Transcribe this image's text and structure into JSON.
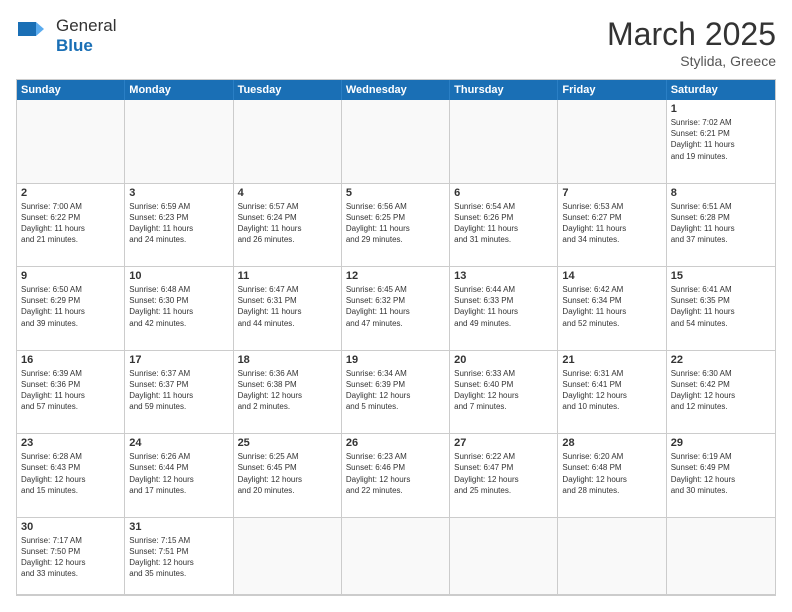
{
  "header": {
    "logo_general": "General",
    "logo_blue": "Blue",
    "month_year": "March 2025",
    "location": "Stylida, Greece"
  },
  "weekdays": [
    "Sunday",
    "Monday",
    "Tuesday",
    "Wednesday",
    "Thursday",
    "Friday",
    "Saturday"
  ],
  "cells": [
    {
      "day": "",
      "empty": true
    },
    {
      "day": "",
      "empty": true
    },
    {
      "day": "",
      "empty": true
    },
    {
      "day": "",
      "empty": true
    },
    {
      "day": "",
      "empty": true
    },
    {
      "day": "",
      "empty": true
    },
    {
      "day": "1",
      "text": "Sunrise: 7:02 AM\nSunset: 6:21 PM\nDaylight: 11 hours\nand 19 minutes."
    },
    {
      "day": "2",
      "text": "Sunrise: 7:00 AM\nSunset: 6:22 PM\nDaylight: 11 hours\nand 21 minutes."
    },
    {
      "day": "3",
      "text": "Sunrise: 6:59 AM\nSunset: 6:23 PM\nDaylight: 11 hours\nand 24 minutes."
    },
    {
      "day": "4",
      "text": "Sunrise: 6:57 AM\nSunset: 6:24 PM\nDaylight: 11 hours\nand 26 minutes."
    },
    {
      "day": "5",
      "text": "Sunrise: 6:56 AM\nSunset: 6:25 PM\nDaylight: 11 hours\nand 29 minutes."
    },
    {
      "day": "6",
      "text": "Sunrise: 6:54 AM\nSunset: 6:26 PM\nDaylight: 11 hours\nand 31 minutes."
    },
    {
      "day": "7",
      "text": "Sunrise: 6:53 AM\nSunset: 6:27 PM\nDaylight: 11 hours\nand 34 minutes."
    },
    {
      "day": "8",
      "text": "Sunrise: 6:51 AM\nSunset: 6:28 PM\nDaylight: 11 hours\nand 37 minutes."
    },
    {
      "day": "9",
      "text": "Sunrise: 6:50 AM\nSunset: 6:29 PM\nDaylight: 11 hours\nand 39 minutes."
    },
    {
      "day": "10",
      "text": "Sunrise: 6:48 AM\nSunset: 6:30 PM\nDaylight: 11 hours\nand 42 minutes."
    },
    {
      "day": "11",
      "text": "Sunrise: 6:47 AM\nSunset: 6:31 PM\nDaylight: 11 hours\nand 44 minutes."
    },
    {
      "day": "12",
      "text": "Sunrise: 6:45 AM\nSunset: 6:32 PM\nDaylight: 11 hours\nand 47 minutes."
    },
    {
      "day": "13",
      "text": "Sunrise: 6:44 AM\nSunset: 6:33 PM\nDaylight: 11 hours\nand 49 minutes."
    },
    {
      "day": "14",
      "text": "Sunrise: 6:42 AM\nSunset: 6:34 PM\nDaylight: 11 hours\nand 52 minutes."
    },
    {
      "day": "15",
      "text": "Sunrise: 6:41 AM\nSunset: 6:35 PM\nDaylight: 11 hours\nand 54 minutes."
    },
    {
      "day": "16",
      "text": "Sunrise: 6:39 AM\nSunset: 6:36 PM\nDaylight: 11 hours\nand 57 minutes."
    },
    {
      "day": "17",
      "text": "Sunrise: 6:37 AM\nSunset: 6:37 PM\nDaylight: 11 hours\nand 59 minutes."
    },
    {
      "day": "18",
      "text": "Sunrise: 6:36 AM\nSunset: 6:38 PM\nDaylight: 12 hours\nand 2 minutes."
    },
    {
      "day": "19",
      "text": "Sunrise: 6:34 AM\nSunset: 6:39 PM\nDaylight: 12 hours\nand 5 minutes."
    },
    {
      "day": "20",
      "text": "Sunrise: 6:33 AM\nSunset: 6:40 PM\nDaylight: 12 hours\nand 7 minutes."
    },
    {
      "day": "21",
      "text": "Sunrise: 6:31 AM\nSunset: 6:41 PM\nDaylight: 12 hours\nand 10 minutes."
    },
    {
      "day": "22",
      "text": "Sunrise: 6:30 AM\nSunset: 6:42 PM\nDaylight: 12 hours\nand 12 minutes."
    },
    {
      "day": "23",
      "text": "Sunrise: 6:28 AM\nSunset: 6:43 PM\nDaylight: 12 hours\nand 15 minutes."
    },
    {
      "day": "24",
      "text": "Sunrise: 6:26 AM\nSunset: 6:44 PM\nDaylight: 12 hours\nand 17 minutes."
    },
    {
      "day": "25",
      "text": "Sunrise: 6:25 AM\nSunset: 6:45 PM\nDaylight: 12 hours\nand 20 minutes."
    },
    {
      "day": "26",
      "text": "Sunrise: 6:23 AM\nSunset: 6:46 PM\nDaylight: 12 hours\nand 22 minutes."
    },
    {
      "day": "27",
      "text": "Sunrise: 6:22 AM\nSunset: 6:47 PM\nDaylight: 12 hours\nand 25 minutes."
    },
    {
      "day": "28",
      "text": "Sunrise: 6:20 AM\nSunset: 6:48 PM\nDaylight: 12 hours\nand 28 minutes."
    },
    {
      "day": "29",
      "text": "Sunrise: 6:19 AM\nSunset: 6:49 PM\nDaylight: 12 hours\nand 30 minutes."
    },
    {
      "day": "30",
      "text": "Sunrise: 7:17 AM\nSunset: 7:50 PM\nDaylight: 12 hours\nand 33 minutes.",
      "last": true
    },
    {
      "day": "31",
      "text": "Sunrise: 7:15 AM\nSunset: 7:51 PM\nDaylight: 12 hours\nand 35 minutes.",
      "last": true
    },
    {
      "day": "",
      "empty": true,
      "last": true
    },
    {
      "day": "",
      "empty": true,
      "last": true
    },
    {
      "day": "",
      "empty": true,
      "last": true
    },
    {
      "day": "",
      "empty": true,
      "last": true
    },
    {
      "day": "",
      "empty": true,
      "last": true
    }
  ]
}
